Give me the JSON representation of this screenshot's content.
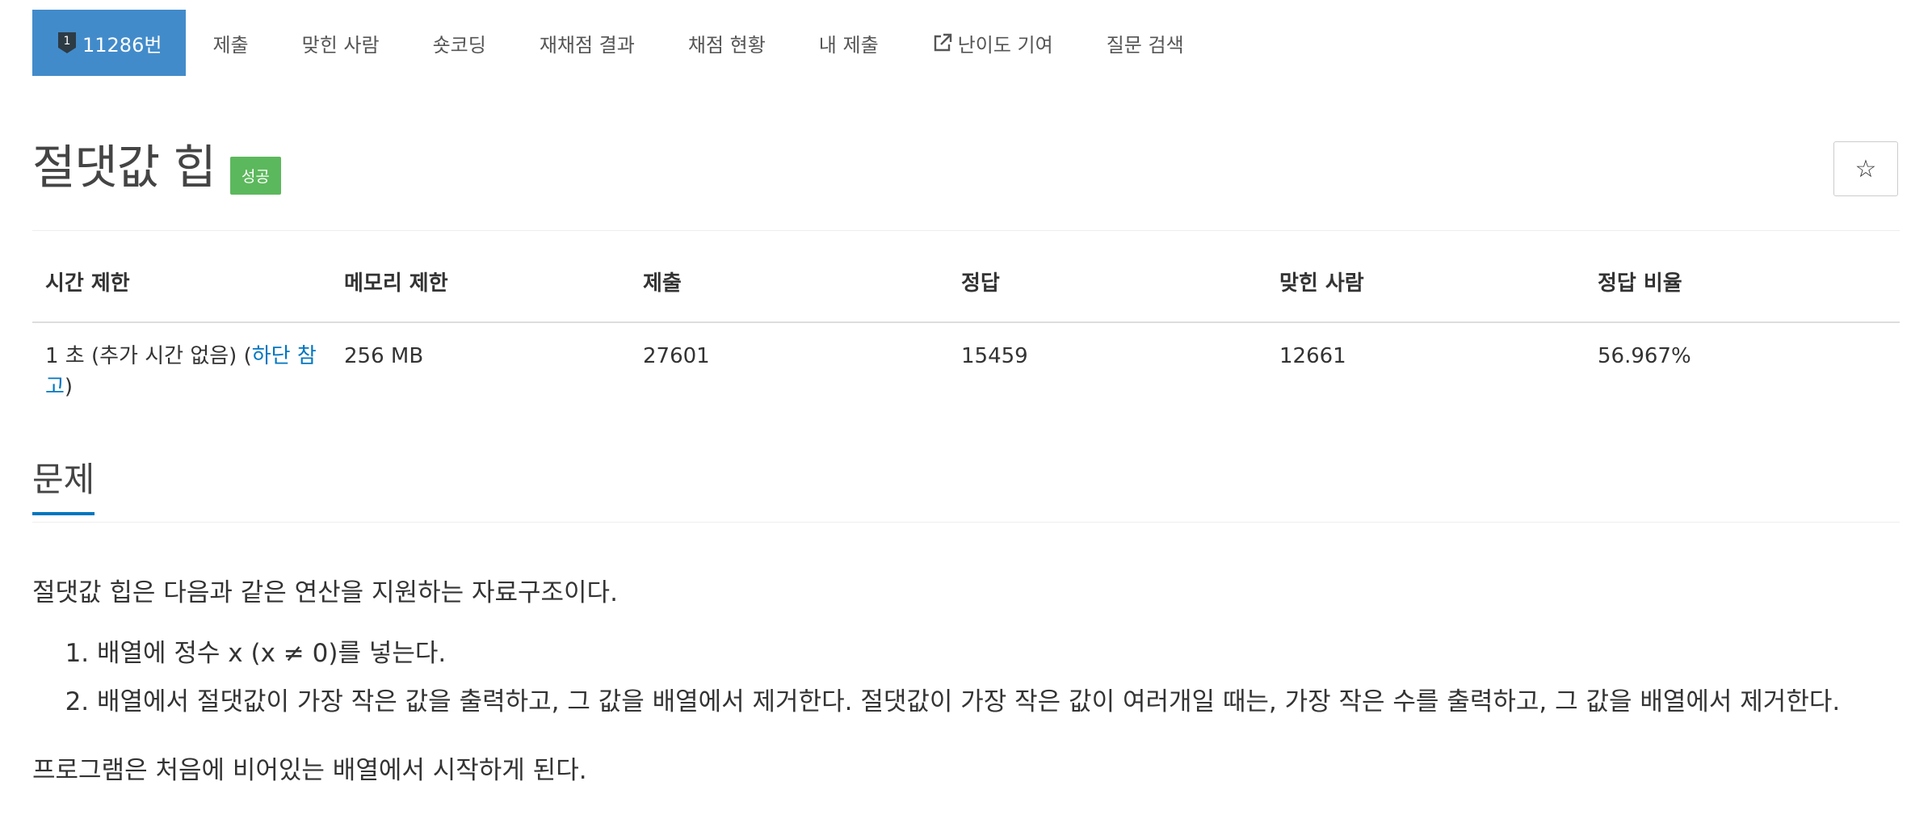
{
  "nav": {
    "problem_number": "11286번",
    "badge_level": "1",
    "items": [
      "제출",
      "맞힌 사람",
      "숏코딩",
      "재채점 결과",
      "채점 현황",
      "내 제출",
      "난이도 기여",
      "질문 검색"
    ]
  },
  "problem": {
    "title": "절댓값 힙",
    "status_badge": "성공",
    "star_icon": "☆"
  },
  "info_table": {
    "headers": [
      "시간 제한",
      "메모리 제한",
      "제출",
      "정답",
      "맞힌 사람",
      "정답 비율"
    ],
    "time_limit_prefix": "1 초 (추가 시간 없음) (",
    "time_limit_link": "하단 참고",
    "time_limit_suffix": ")",
    "memory_limit": "256 MB",
    "submissions": "27601",
    "accepted": "15459",
    "solved_users": "12661",
    "accept_ratio": "56.967%"
  },
  "section": {
    "title": "문제",
    "intro": "절댓값 힙은 다음과 같은 연산을 지원하는 자료구조이다.",
    "operations": [
      "배열에 정수 x (x ≠ 0)를 넣는다.",
      "배열에서 절댓값이 가장 작은 값을 출력하고, 그 값을 배열에서 제거한다. 절댓값이 가장 작은 값이 여러개일 때는, 가장 작은 수를 출력하고, 그 값을 배열에서 제거한다."
    ],
    "outro": "프로그램은 처음에 비어있는 배열에서 시작하게 된다."
  },
  "colors": {
    "active_tab": "#428bca",
    "success_badge": "#5cb85c",
    "link": "#0076c0"
  }
}
